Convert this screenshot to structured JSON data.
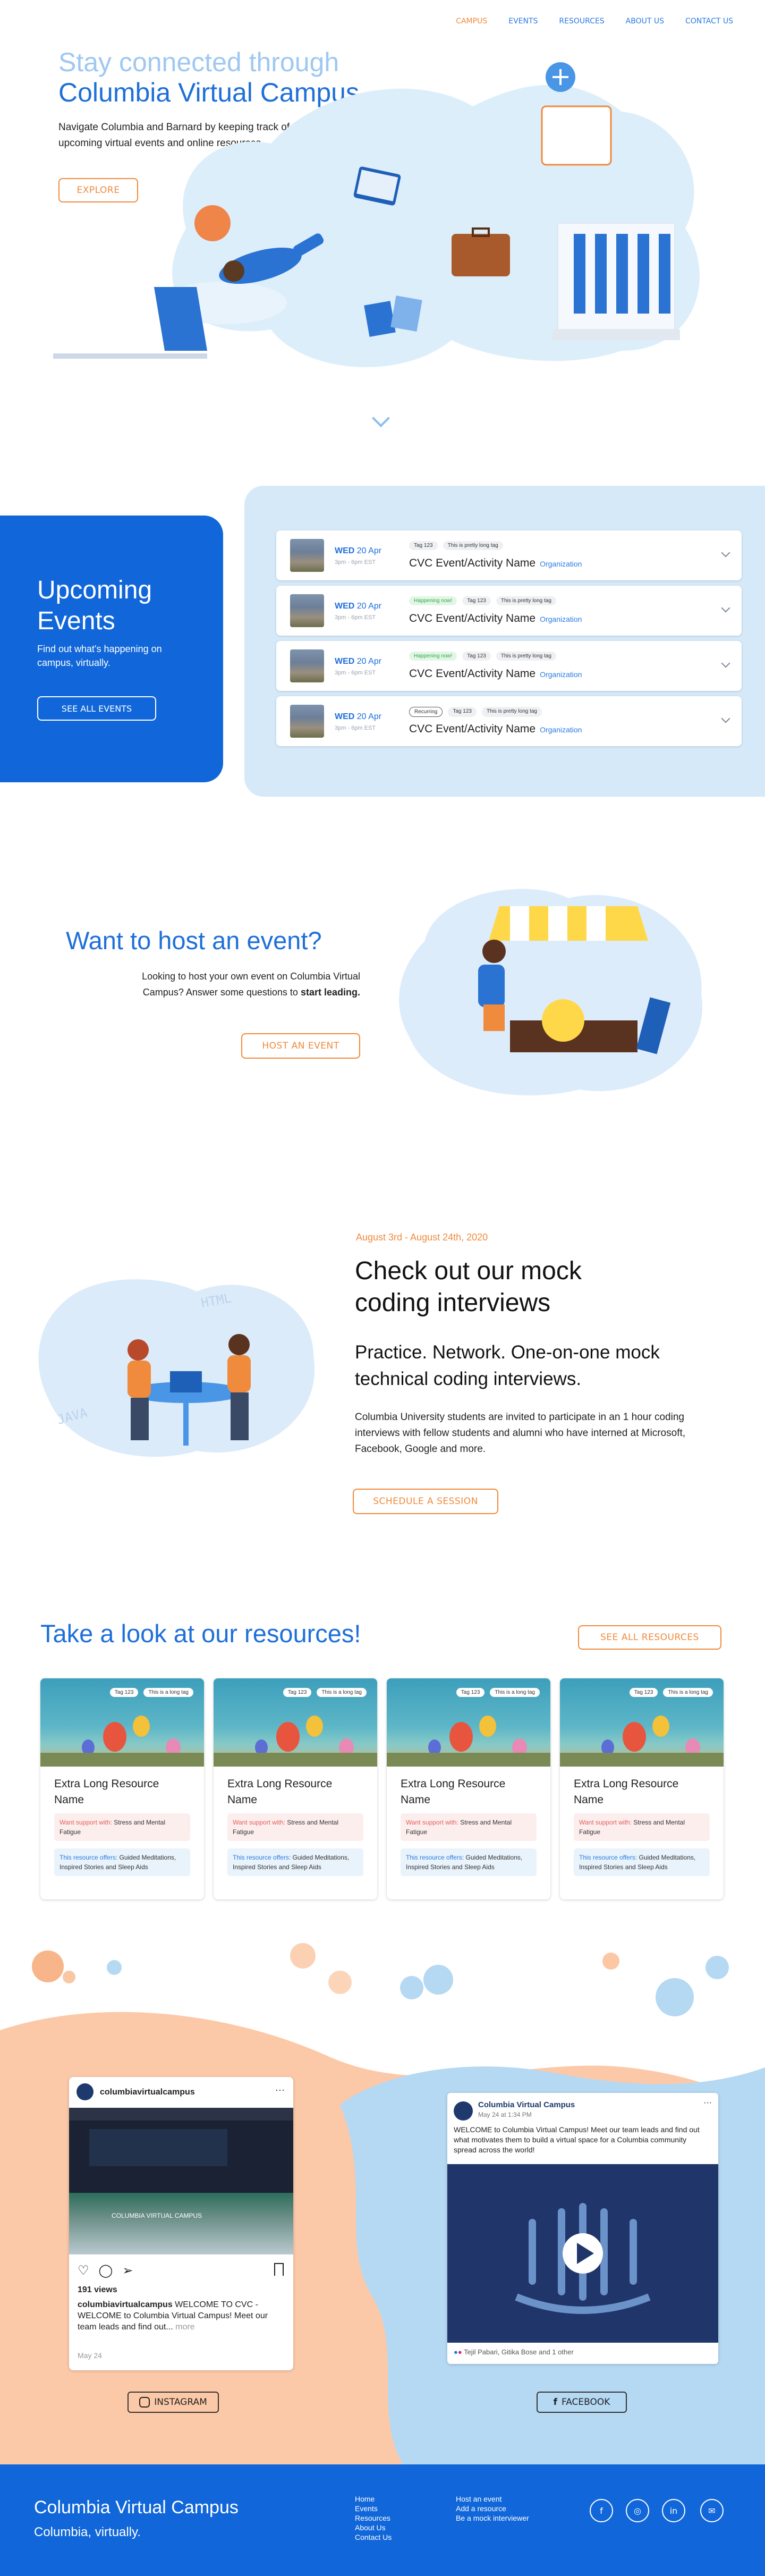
{
  "nav": {
    "items": [
      "CAMPUS",
      "EVENTS",
      "RESOURCES",
      "ABOUT US",
      "CONTACT US"
    ]
  },
  "hero": {
    "title_line1": "Stay connected through",
    "title_line2": "Columbia Virtual Campus",
    "description": "Navigate Columbia and Barnard by keeping track of upcoming virtual events and online resources",
    "explore_label": "EXPLORE"
  },
  "events": {
    "heading_line1": "Upcoming",
    "heading_line2": "Events",
    "subtext": "Find out what's happening on campus, virtually.",
    "see_all_label": "SEE ALL EVENTS",
    "items": [
      {
        "weekday": "WED",
        "date": "20 Apr",
        "time": "3pm - 6pm EST",
        "name": "CVC Event/Activity Name",
        "org": "Organization",
        "tags": [
          "Tag 123",
          "This is pretty long tag"
        ]
      },
      {
        "weekday": "WED",
        "date": "20 Apr",
        "time": "3pm - 6pm EST",
        "name": "CVC Event/Activity Name",
        "org": "Organization",
        "tags": [
          "Happening now!",
          "Tag 123",
          "This is pretty long tag"
        ]
      },
      {
        "weekday": "WED",
        "date": "20 Apr",
        "time": "3pm - 6pm EST",
        "name": "CVC Event/Activity Name",
        "org": "Organization",
        "tags": [
          "Happening now!",
          "Tag 123",
          "This is pretty long tag"
        ]
      },
      {
        "weekday": "WED",
        "date": "20 Apr",
        "time": "3pm - 6pm EST",
        "name": "CVC Event/Activity Name",
        "org": "Organization",
        "tags": [
          "Recurring",
          "Tag 123",
          "This is pretty long tag"
        ]
      }
    ]
  },
  "host": {
    "title": "Want to host an event?",
    "description": "Looking to host your own event on Columbia Virtual Campus? Answer some questions to",
    "description_bold": "start leading.",
    "button_label": "HOST AN EVENT"
  },
  "mock": {
    "date": "August 3rd - August 24th, 2020",
    "title": "Check out our mock coding interviews",
    "subtitle": "Practice. Network. One-on-one mock technical coding interviews.",
    "description": "Columbia University students are invited to participate in an 1 hour coding interviews with fellow students and alumni who have interned at Microsoft, Facebook, Google and more.",
    "button_label": "SCHEDULE A SESSION",
    "illustration_labels": [
      "HTML",
      "JAVA"
    ]
  },
  "resources": {
    "title": "Take a look at our resources!",
    "see_all_label": "SEE ALL RESOURCES",
    "cards": [
      {
        "name": "Extra Long Resource Name",
        "tags": [
          "Tag 123",
          "This is a long tag"
        ],
        "support_label": "Want support with:",
        "support_value": "Stress and Mental Fatigue",
        "offers_label": "This resource offers:",
        "offers_value": "Guided Meditations, Inspired Stories and Sleep Aids"
      },
      {
        "name": "Extra Long Resource Name",
        "tags": [
          "Tag 123",
          "This is a long tag"
        ],
        "support_label": "Want support with:",
        "support_value": "Stress and Mental Fatigue",
        "offers_label": "This resource offers:",
        "offers_value": "Guided Meditations, Inspired Stories and Sleep Aids"
      },
      {
        "name": "Extra Long Resource Name",
        "tags": [
          "Tag 123",
          "This is a long tag"
        ],
        "support_label": "Want support with:",
        "support_value": "Stress and Mental Fatigue",
        "offers_label": "This resource offers:",
        "offers_value": "Guided Meditations, Inspired Stories and Sleep Aids"
      },
      {
        "name": "Extra Long Resource Name",
        "tags": [
          "Tag 123",
          "This is a long tag"
        ],
        "support_label": "Want support with:",
        "support_value": "Stress and Mental Fatigue",
        "offers_label": "This resource offers:",
        "offers_value": "Guided Meditations, Inspired Stories and Sleep Aids"
      }
    ]
  },
  "instagram": {
    "username": "columbiavirtualcampus",
    "screen_text": "COLUMBIA VIRTUAL CAMPUS",
    "views": "191 views",
    "caption_user": "columbiavirtualcampus",
    "caption": "WELCOME TO CVC - WELCOME to Columbia Virtual Campus! Meet our team leads and find out...",
    "more": "more",
    "date": "May 24",
    "button_label": "INSTAGRAM"
  },
  "facebook": {
    "page_name": "Columbia Virtual Campus",
    "post_time": "May 24 at 1:34 PM",
    "post_text": "WELCOME to Columbia Virtual Campus! Meet our team leads and find out what motivates them to build a virtual space for a Columbia community spread across the world!",
    "reactions": "Tejil Pabari, Gitika Bose and 1 other",
    "button_label": "FACEBOOK"
  },
  "footer": {
    "brand": "Columbia Virtual Campus",
    "tagline": "Columbia, virtually.",
    "col1": [
      "Home",
      "Events",
      "Resources",
      "About Us",
      "Contact Us"
    ],
    "col2": [
      "Host an event",
      "Add a resource",
      "Be a mock interviewer"
    ],
    "icons": [
      "f",
      "◎",
      "in",
      "✉"
    ]
  },
  "colors": {
    "primary_blue": "#1167d9",
    "accent_orange": "#f08a3c",
    "light_blue": "#d5e9f8",
    "peach": "#fcc9a8"
  }
}
